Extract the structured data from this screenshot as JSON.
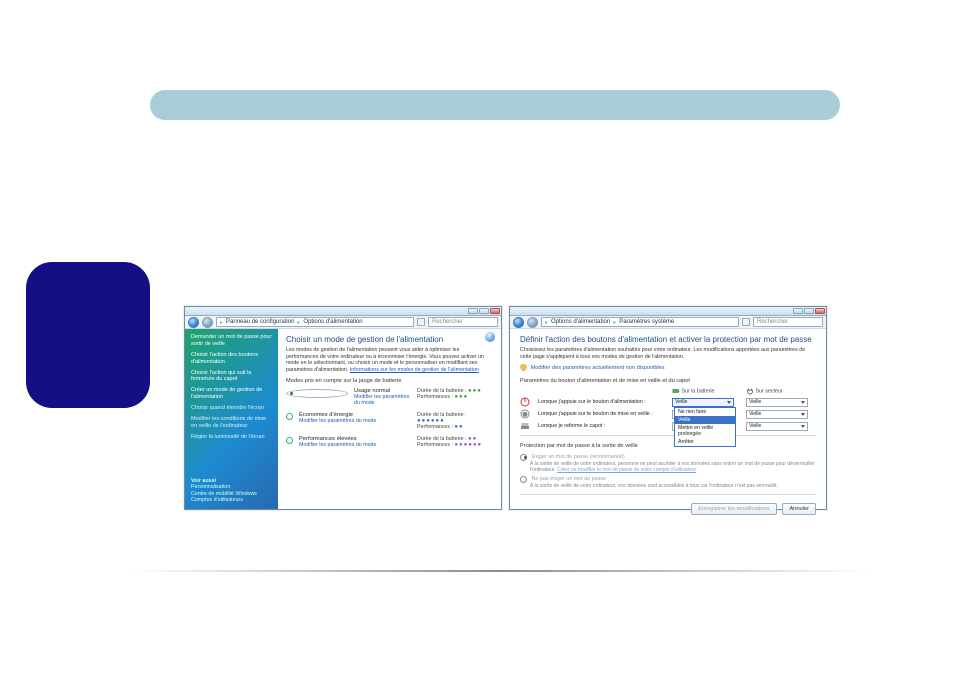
{
  "window1": {
    "breadcrumb": [
      "Panneau de configuration",
      "Options d'alimentation"
    ],
    "search_placeholder": "Rechercher",
    "sidebar": {
      "items": [
        "Demander un mot de passe pour sortir de veille",
        "Choisir l'action des boutons d'alimentation",
        "Choisir l'action qui suit la fermeture du capot",
        "Créer un mode de gestion de l'alimentation",
        "Choisir quand éteindre l'écran",
        "Modifier les conditions de mise en veille de l'ordinateur",
        "Régler la luminosité de l'écran"
      ],
      "see_also_label": "Voir aussi",
      "see_also": [
        "Personnalisation",
        "Centre de mobilité Windows",
        "Comptes d'utilisateurs"
      ]
    },
    "title": "Choisir un mode de gestion de l'alimentation",
    "description": "Les modes de gestion de l'alimentation peuvent vous aider à optimiser les performances de votre ordinateur ou à économiser l'énergie. Vous pouvez activer un mode en le sélectionnant, ou choisir un mode et le personnaliser en modifiant ses paramètres d'alimentation.",
    "description_link": "Informations sur les modes de gestion de l'alimentation",
    "gauge_label": "Modes pris en compte sur la jauge de batterie",
    "battery_label": "Durée de la batterie :",
    "perf_label": "Performances :",
    "change_link": "Modifier les paramètres du mode",
    "plans": [
      {
        "name": "Usage normal",
        "selected": true,
        "batt": "ggg",
        "perf": "ggg"
      },
      {
        "name": "Économies d'énergie",
        "selected": false,
        "batt": "bbbbbb",
        "perf": "bb"
      },
      {
        "name": "Performances élevées",
        "selected": false,
        "batt": "pp",
        "perf": "pppppp"
      }
    ]
  },
  "window2": {
    "breadcrumb": [
      "Options d'alimentation",
      "Paramètres système"
    ],
    "search_placeholder": "Rechercher",
    "title": "Définir l'action des boutons d'alimentation et activer la protection par mot de passe",
    "description": "Choisissez les paramètres d'alimentation souhaités pour votre ordinateur. Les modifications apportées aux paramètres de cette page s'appliquent à tous vos modes de gestion de l'alimentation.",
    "unlock_link": "Modifier des paramètres actuellement non disponibles",
    "group1": "Paramètres du bouton d'alimentation et de mise en veille et du capot",
    "col_batt": "Sur la batterie",
    "col_ac": "Sur secteur",
    "rows": [
      {
        "label": "Lorsque j'appuie sur le bouton d'alimentation :",
        "batt": "Veille",
        "ac": "Veille",
        "open": true
      },
      {
        "label": "Lorsque j'appuie sur le bouton de mise en veille :",
        "batt": "Veille",
        "ac": "Veille"
      },
      {
        "label": "Lorsque je referme le capot :",
        "batt": "Veille",
        "ac": "Veille"
      }
    ],
    "dropdown_options": [
      "Ne rien faire",
      "Veille",
      "Mettre en veille prolongée",
      "Arrêter"
    ],
    "group2": "Protection par mot de passe à la sortie de veille",
    "opt_require": {
      "title": "Exiger un mot de passe (recommandé)",
      "sub": "À la sortie de veille de votre ordinateur, personne ne peut accéder à vos données sans entrer un mot de passe pour déverrouiller l'ordinateur.",
      "link": "Créer ou modifier le mot de passe de votre compte d'utilisateur"
    },
    "opt_norequire": {
      "title": "Ne pas exiger un mot de passe",
      "sub": "À la sortie de veille de votre ordinateur, vos données sont accessibles à tous car l'ordinateur n'est pas verrouillé."
    },
    "btn_save": "Enregistrer les modifications",
    "btn_cancel": "Annuler"
  }
}
